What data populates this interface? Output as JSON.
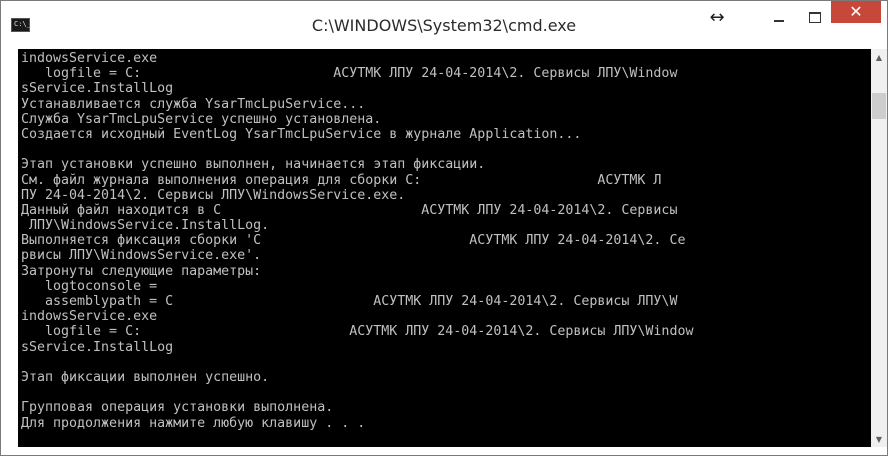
{
  "window": {
    "title": "C:\\WINDOWS\\System32\\cmd.exe",
    "icon_label": "C:\\_",
    "controls": {
      "resize_glyph": "↔",
      "close_glyph": "✕"
    }
  },
  "console": {
    "lines": [
      "indowsService.exe",
      "   logfile = C:                        АСУТМК ЛПУ 24-04-2014\\2. Сервисы ЛПУ\\Window",
      "sService.InstallLog",
      "Устанавливается служба YsarTmcLpuService...",
      "Служба YsarTmcLpuService успешно установлена.",
      "Создается исходный EventLog YsarTmcLpuService в журнале Application...",
      "",
      "Этап установки успешно выполнен, начинается этап фиксации.",
      "См. файл журнала выполнения операция для сборки C:                      АСУТМК Л",
      "ПУ 24-04-2014\\2. Сервисы ЛПУ\\WindowsService.exe.",
      "Данный файл находится в C                         АСУТМК ЛПУ 24-04-2014\\2. Сервисы",
      " ЛПУ\\WindowsService.InstallLog.",
      "Выполняется фиксация сборки 'C                          АСУТМК ЛПУ 24-04-2014\\2. Се",
      "рвисы ЛПУ\\WindowsService.exe'.",
      "Затронуты следующие параметры:",
      "   logtoconsole =",
      "   assemblypath = C                         АСУТМК ЛПУ 24-04-2014\\2. Сервисы ЛПУ\\W",
      "indowsService.exe",
      "   logfile = C:                          АСУТМК ЛПУ 24-04-2014\\2. Сервисы ЛПУ\\Window",
      "sService.InstallLog",
      "",
      "Этап фиксации выполнен успешно.",
      "",
      "Групповая операция установки выполнена.",
      "Для продолжения нажмите любую клавишу . . ."
    ]
  },
  "scrollbar": {
    "up_glyph": "▲",
    "down_glyph": "▼"
  },
  "colors": {
    "console_bg": "#000000",
    "console_fg": "#c0c0c0",
    "close_button": "#c7473a"
  }
}
